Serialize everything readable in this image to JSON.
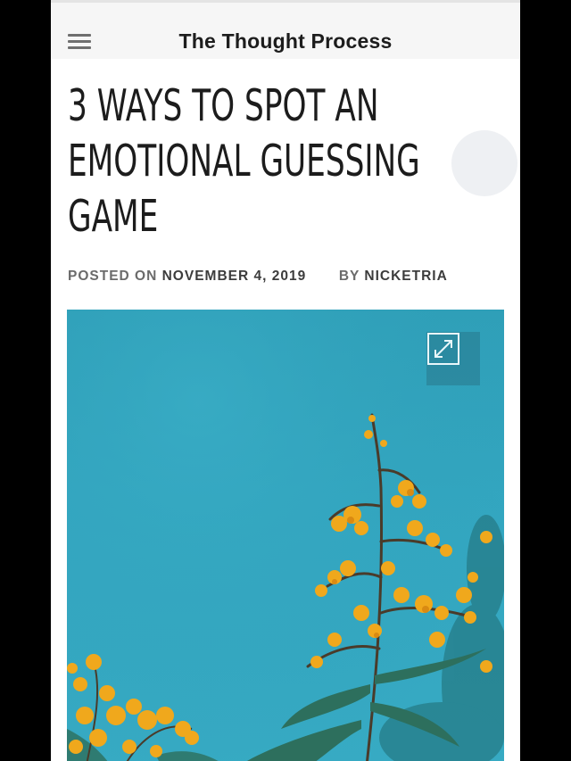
{
  "header": {
    "site_title": "The Thought Process",
    "menu_icon": "hamburger-menu-icon"
  },
  "post": {
    "title_lines": [
      "3 WAYS TO SPOT AN",
      "EMOTIONAL GUESSING",
      "GAME"
    ],
    "meta": {
      "posted_on_label": "POSTED ON",
      "date": "NOVEMBER 4, 2019",
      "by_label": "BY",
      "author": "NICKETRIA"
    }
  },
  "hero_image": {
    "alt_subject": "yellow-flowers-against-blue-sky",
    "expand_icon": "expand-arrows-icon"
  },
  "colors": {
    "background": "#ffffff",
    "topbar": "#f6f6f6",
    "sky": "#33a6c0",
    "flowers": "#f0a81c"
  }
}
